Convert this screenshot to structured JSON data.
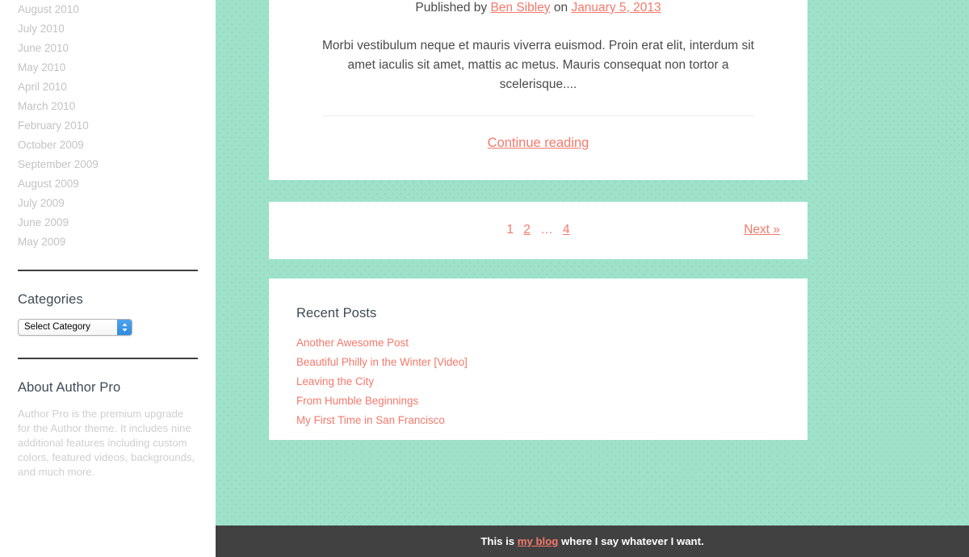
{
  "theme": {
    "accent_color": "#f4796b",
    "background_color": "#9ee2ca",
    "footer_color": "#414141",
    "sidebar_background": "#ffffff",
    "card_background": "#ffffff",
    "muted_text_color": "#c3c3c3",
    "heading_color": "#3f4a54"
  },
  "sidebar": {
    "archives": [
      {
        "label": "August 2010"
      },
      {
        "label": "July 2010"
      },
      {
        "label": "June 2010"
      },
      {
        "label": "May 2010"
      },
      {
        "label": "April 2010"
      },
      {
        "label": "March 2010"
      },
      {
        "label": "February 2010"
      },
      {
        "label": "October 2009"
      },
      {
        "label": "September 2009"
      },
      {
        "label": "August 2009"
      },
      {
        "label": "July 2009"
      },
      {
        "label": "June 2009"
      },
      {
        "label": "May 2009"
      }
    ],
    "categories": {
      "heading": "Categories",
      "select_value": "Select Category"
    },
    "about": {
      "heading": "About Author Pro",
      "body": "Author Pro is the premium upgrade for the Author theme. It includes nine additional features including custom colors, featured videos, backgrounds, and much more."
    }
  },
  "post": {
    "byline_prefix": "Published by",
    "author": "Ben Sibley",
    "byline_joiner": "on",
    "date": "January 5, 2013",
    "excerpt": "Morbi vestibulum neque et mauris viverra euismod. Proin erat elit, interdum sit amet iaculis sit amet, mattis ac metus. Mauris consequat non tortor a scelerisque....",
    "continue_label": "Continue reading"
  },
  "pagination": {
    "pages": [
      {
        "label": "1",
        "current": true
      },
      {
        "label": "2",
        "current": false
      },
      {
        "label": "…",
        "current": false
      },
      {
        "label": "4",
        "current": false
      }
    ],
    "next_label": "Next »"
  },
  "recent_posts": {
    "heading": "Recent Posts",
    "items": [
      {
        "label": "Another Awesome Post"
      },
      {
        "label": "Beautiful Philly in the Winter [Video]"
      },
      {
        "label": "Leaving the City"
      },
      {
        "label": "From Humble Beginnings"
      },
      {
        "label": "My First Time in San Francisco"
      }
    ]
  },
  "footer": {
    "text_before": "This is",
    "link": "my blog",
    "text_after": "where I say whatever I want."
  }
}
